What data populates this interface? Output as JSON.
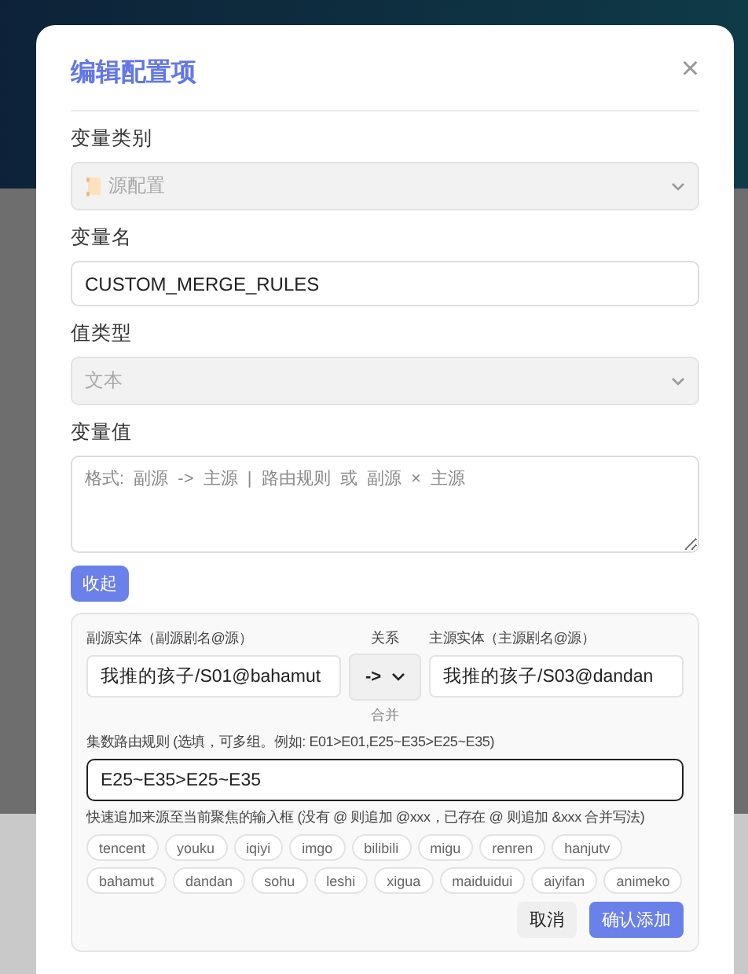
{
  "dialog": {
    "title": "编辑配置项",
    "close": "×",
    "fields": [
      {
        "kind": "select",
        "label": "变量类别",
        "value": "源配置",
        "has_icon": true,
        "disabled": true
      },
      {
        "kind": "input",
        "label": "变量名",
        "value": "CUSTOM_MERGE_RULES"
      },
      {
        "kind": "select",
        "label": "值类型",
        "value": "文本",
        "has_icon": false,
        "disabled": true
      },
      {
        "kind": "textarea",
        "label": "变量值",
        "placeholder": "格式: 副源 -> 主源 | 路由规则 或 副源 × 主源"
      }
    ],
    "collapse_button": "收起",
    "panel": {
      "source_label": "副源实体（副源剧名@源）",
      "source_value": "我推的孩子/S01@bahamut",
      "relation_label": "关系",
      "relation_value": "->",
      "relation_hint": "合并",
      "target_label": "主源实体（主源剧名@源）",
      "target_value": "我推的孩子/S03@dandan",
      "route_label": "集数路由规则 (选填，可多组。例如: E01>E01,E25~E35>E25~E35)",
      "route_value": "E25~E35>E25~E35",
      "route_focused": true,
      "quick_label": "快速追加来源至当前聚焦的输入框 (没有 @ 则追加 @xxx，已存在 @ 则追加 &xxx 合并写法)",
      "chips": [
        "tencent",
        "youku",
        "iqiyi",
        "imgo",
        "bilibili",
        "migu",
        "renren",
        "hanjutv",
        "bahamut",
        "dandan",
        "sohu",
        "leshi",
        "xigua",
        "maiduidui",
        "aiyifan",
        "animeko"
      ],
      "cancel_button": "取消",
      "confirm_button": "确认添加"
    }
  }
}
